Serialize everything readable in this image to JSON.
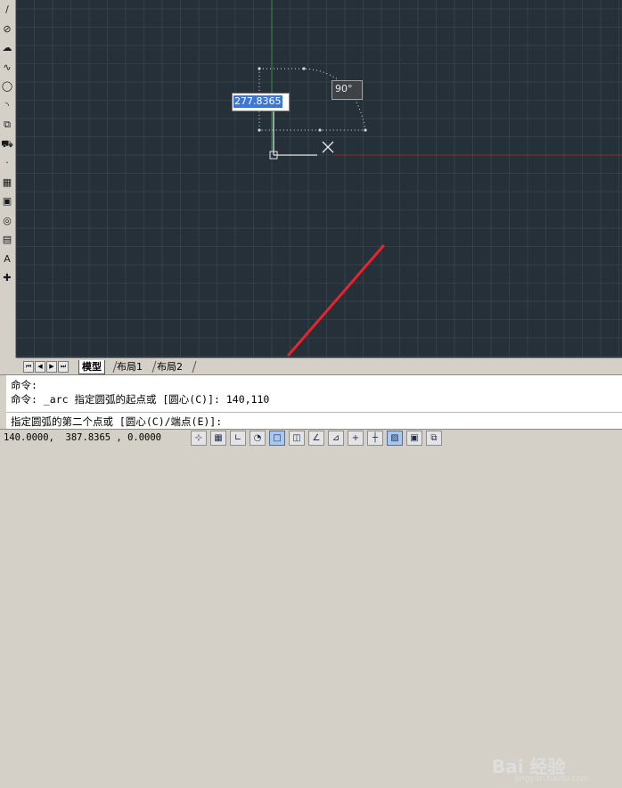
{
  "toolbar": {
    "tools": [
      {
        "name": "line-tool-icon",
        "glyph": "/"
      },
      {
        "name": "circle-tool-icon",
        "glyph": "⊘"
      },
      {
        "name": "revision-cloud-tool-icon",
        "glyph": "☁"
      },
      {
        "name": "spline-tool-icon",
        "glyph": "∿"
      },
      {
        "name": "ellipse-tool-icon",
        "glyph": "◯"
      },
      {
        "name": "ellipse-arc-tool-icon",
        "glyph": "◝"
      },
      {
        "name": "insert-block-tool-icon",
        "glyph": "⧉"
      },
      {
        "name": "make-block-tool-icon",
        "glyph": "⛟"
      },
      {
        "name": "point-tool-icon",
        "glyph": "·"
      },
      {
        "name": "hatch-tool-icon",
        "glyph": "▦"
      },
      {
        "name": "gradient-tool-icon",
        "glyph": "▣"
      },
      {
        "name": "region-tool-icon",
        "glyph": "◎"
      },
      {
        "name": "table-tool-icon",
        "glyph": "▤"
      },
      {
        "name": "text-tool-icon",
        "glyph": "A"
      },
      {
        "name": "add-selected-tool-icon",
        "glyph": "✚"
      }
    ]
  },
  "canvas": {
    "dynamic_input_value": "277.8365",
    "angle_tooltip": "90°",
    "colors": {
      "background": "#263038",
      "grid_major": "#33404c",
      "grid_minor": "#2b353f",
      "y_axis": "#2f8f3f",
      "x_track": "#8a2c32",
      "preview": "#e8e8e8"
    }
  },
  "layout_tabs": {
    "nav_buttons": [
      "⏮",
      "◀",
      "▶",
      "⏭"
    ],
    "tabs": [
      "模型",
      "布局1",
      "布局2"
    ]
  },
  "command": {
    "history": [
      "命令:",
      "命令: _arc 指定圆弧的起点或 [圆心(C)]: 140,110"
    ],
    "prompt": "指定圆弧的第二个点或 [圆心(C)/端点(E)]:"
  },
  "status": {
    "coordinates": "140.0000,  387.8365 , 0.0000",
    "buttons": [
      {
        "name": "snap-toggle-icon",
        "glyph": "⊹",
        "on": false
      },
      {
        "name": "grid-toggle-icon",
        "glyph": "▦",
        "on": false
      },
      {
        "name": "ortho-toggle-icon",
        "glyph": "∟",
        "on": false
      },
      {
        "name": "polar-toggle-icon",
        "glyph": "◔",
        "on": false
      },
      {
        "name": "osnap-toggle-icon",
        "glyph": "□",
        "on": true
      },
      {
        "name": "3d-osnap-toggle-icon",
        "glyph": "◫",
        "on": false
      },
      {
        "name": "otrack-toggle-icon",
        "glyph": "∠",
        "on": false
      },
      {
        "name": "ducs-toggle-icon",
        "glyph": "⊿",
        "on": false
      },
      {
        "name": "dyn-toggle-icon",
        "glyph": "+",
        "on": false
      },
      {
        "name": "lineweight-toggle-icon",
        "glyph": "┼",
        "on": false
      },
      {
        "name": "transparency-toggle-icon",
        "glyph": "▨",
        "on": true
      },
      {
        "name": "quick-properties-toggle-icon",
        "glyph": "▣",
        "on": false
      },
      {
        "name": "selection-cycling-toggle-icon",
        "glyph": "⧉",
        "on": false
      }
    ]
  },
  "watermark": {
    "text": "Bai 经验",
    "url": "jingyan.baidu.com"
  }
}
